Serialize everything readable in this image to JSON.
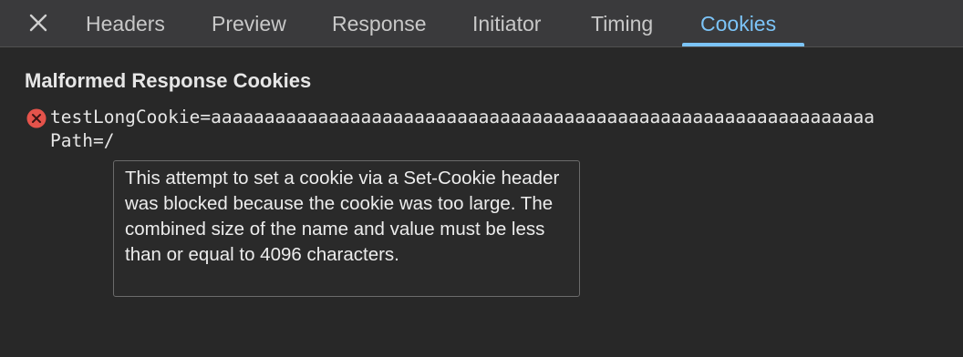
{
  "tabbar": {
    "close_icon": "close-icon",
    "tabs": [
      {
        "label": "Headers"
      },
      {
        "label": "Preview"
      },
      {
        "label": "Response"
      },
      {
        "label": "Initiator"
      },
      {
        "label": "Timing"
      },
      {
        "label": "Cookies",
        "active": true
      }
    ],
    "active_color": "#7cc4f8"
  },
  "content": {
    "section_title": "Malformed Response Cookies",
    "cookie": {
      "status_icon": "error-circle-icon",
      "status_color": "#e5534b",
      "line1": "testLongCookie=aaaaaaaaaaaaaaaaaaaaaaaaaaaaaaaaaaaaaaaaaaaaaaaaaaaaaaaaaaaaaa",
      "line2": "Path=/"
    },
    "tooltip": {
      "text": "This attempt to set a cookie via a Set-Cookie header was blocked because the cookie was too large. The combined size of the name and value must be less than or equal to 4096 characters."
    }
  }
}
